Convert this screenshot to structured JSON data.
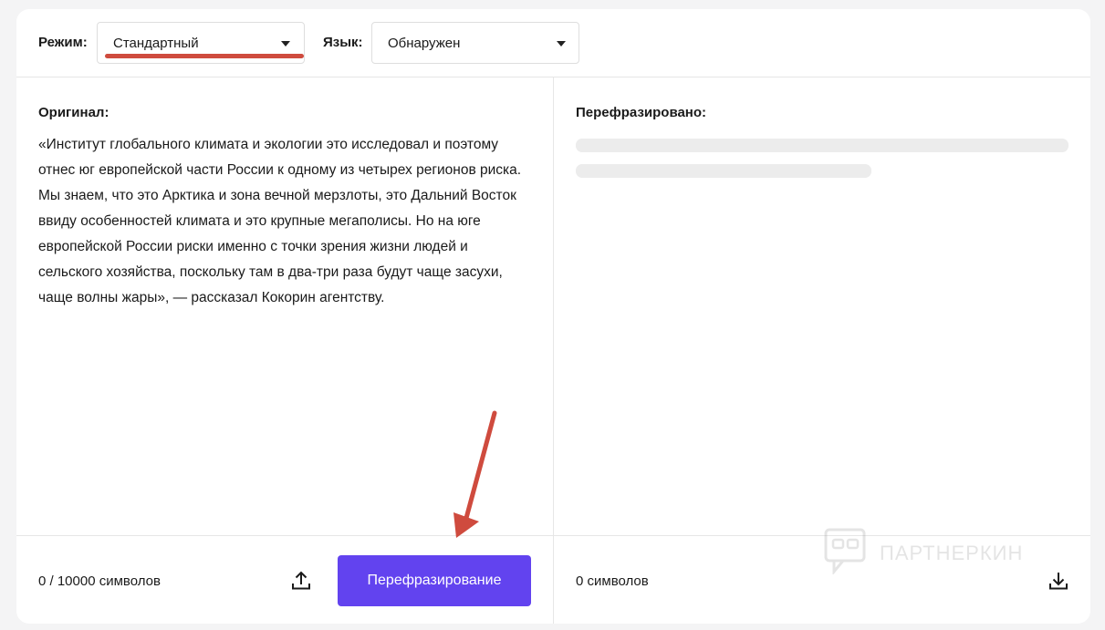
{
  "toolbar": {
    "mode_label": "Режим:",
    "mode_value": "Стандартный",
    "language_label": "Язык:",
    "language_value": "Обнаружен"
  },
  "original": {
    "title": "Оригинал:",
    "text": "«Институт глобального климата и экологии это исследовал и поэтому отнес юг европейской части России к одному из четырех регионов риска. Мы знаем, что это Арктика и зона вечной мерзлоты, это Дальний Восток ввиду особенностей климата и это крупные мегаполисы. Но на юге европейской России риски именно с точки зрения жизни людей и сельского хозяйства, поскольку там в два-три раза будут чаще засухи, чаще волны жары», — рассказал Кокорин агентству.",
    "counter": "0 / 10000 символов",
    "upload_icon": "upload-icon",
    "submit_label": "Перефразирование"
  },
  "result": {
    "title": "Перефразировано:",
    "counter": "0 символов",
    "download_icon": "download-icon"
  },
  "watermark": {
    "text": "ПАРТНЕРКИН"
  },
  "colors": {
    "accent": "#6243ef",
    "annotation": "#cf4b3e",
    "skeleton": "#ececec"
  }
}
